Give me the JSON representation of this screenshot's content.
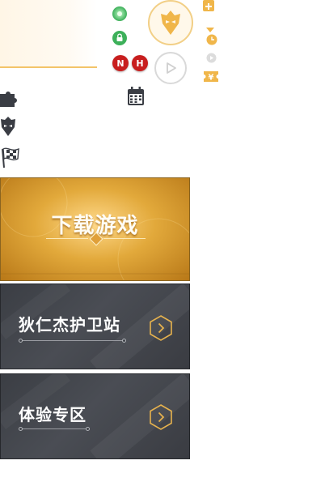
{
  "banners": {
    "download": {
      "title": "下载游戏"
    },
    "guard": {
      "title": "狄仁杰护卫站"
    },
    "trial": {
      "title": "体验专区"
    }
  },
  "badges": {
    "n": "N",
    "h": "H"
  },
  "icons": {
    "green_settings": "gear-icon",
    "green_lock": "lock-icon",
    "avatar_mask": "warrior-mask-icon",
    "play": "play-icon",
    "plus": "plus-icon",
    "dropdown": "caret-down-icon",
    "clock": "clock-icon",
    "play_small": "play-small-icon",
    "yen": "yen-icon",
    "puzzle": "puzzle-icon",
    "shield_mask": "shield-mask-icon",
    "race_flag": "checkered-flag-icon",
    "calendar": "calendar-icon",
    "chevron": "chevron-right-icon"
  },
  "colors": {
    "gold": "#f0b64a",
    "red_badge": "#c81e1e",
    "green": "#3db05a",
    "dark_banner": "#3f4248"
  }
}
